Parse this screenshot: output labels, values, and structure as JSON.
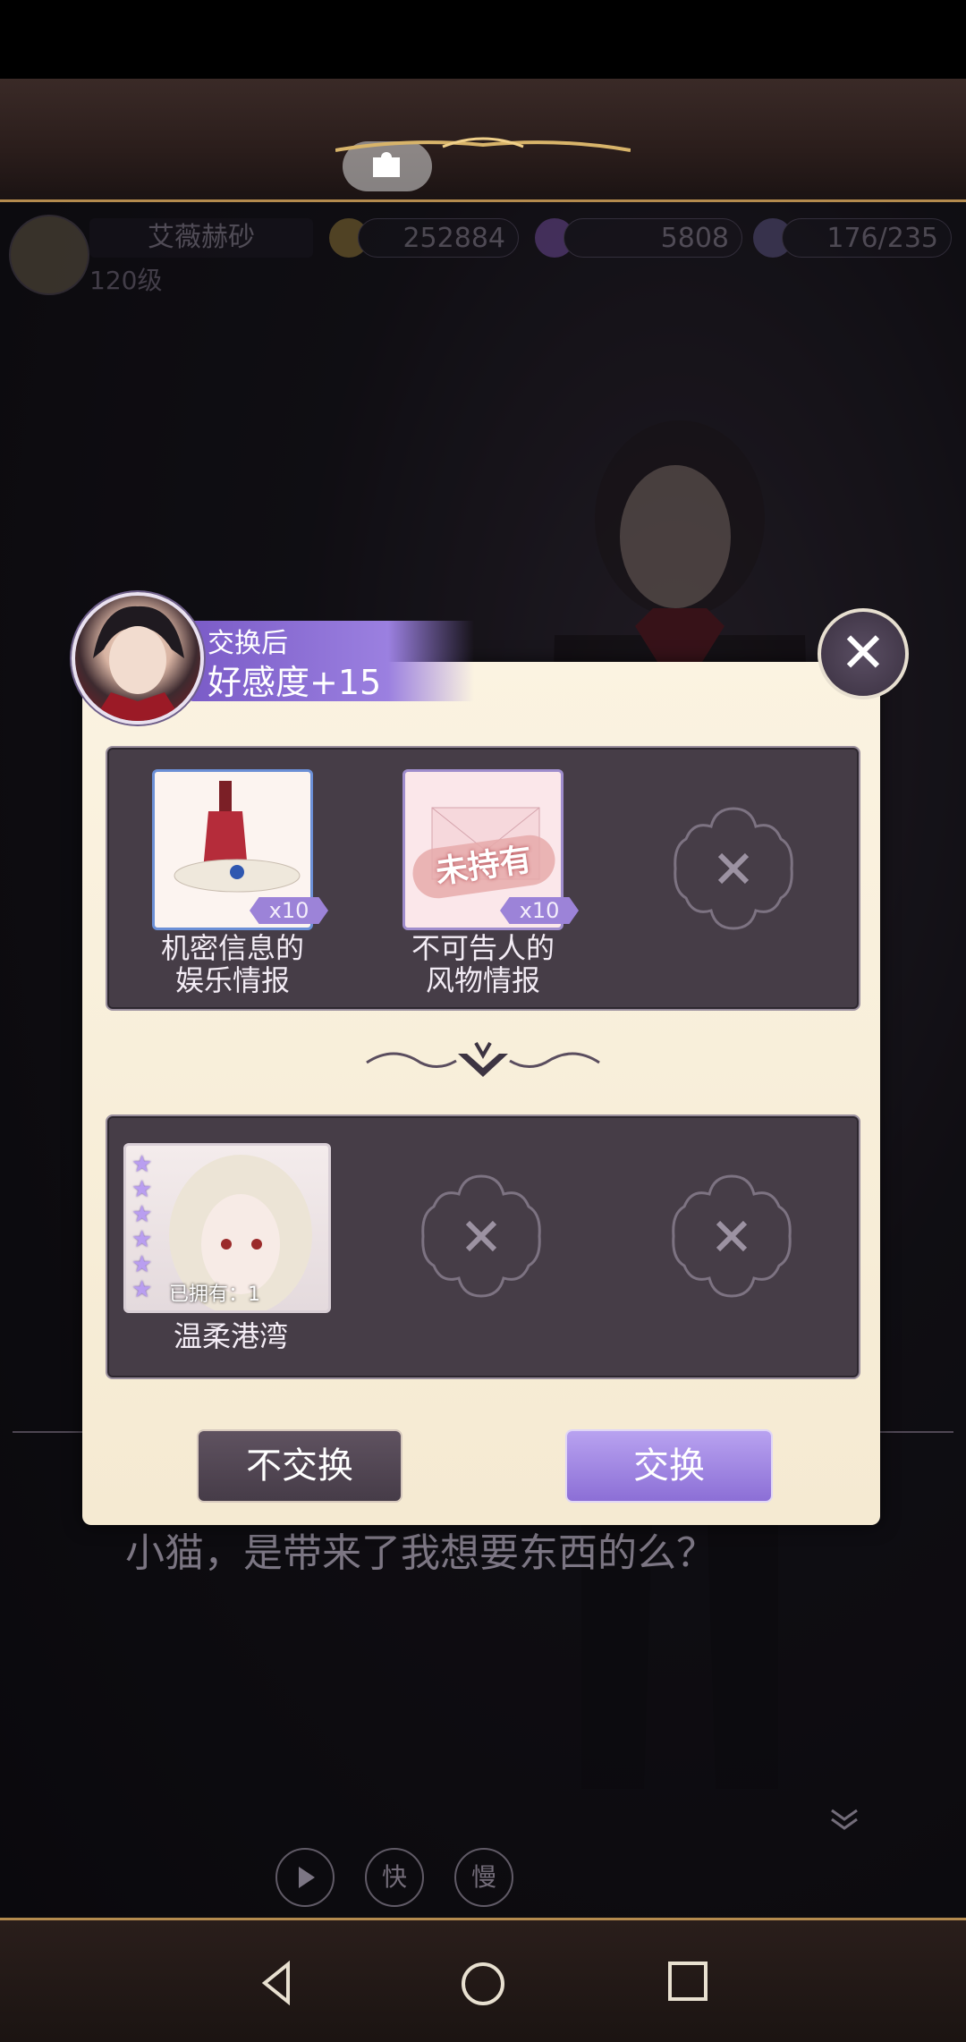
{
  "hud": {
    "player_name": "艾薇赫砂",
    "level": "120级",
    "gold": "252884",
    "gems": "5808",
    "stamina": "176/235"
  },
  "dialogue": {
    "text": "小猫，是带来了我想要东西的么？"
  },
  "controls": {
    "fast": "快",
    "slow": "慢"
  },
  "modal": {
    "banner_line1": "交换后",
    "banner_line2": "好感度+15",
    "close_symbol": "✕",
    "inputs": [
      {
        "name": "机密信息的\n娱乐情报",
        "line1": "机密信息的",
        "line2": "娱乐情报",
        "count": "x10"
      },
      {
        "name": "不可告人的\n风物情报",
        "line1": "不可告人的",
        "line2": "风物情报",
        "count": "x10",
        "status": "未持有"
      }
    ],
    "output": {
      "name": "温柔港湾",
      "owned": "已拥有：1",
      "stars": 6
    },
    "buttons": {
      "decline": "不交换",
      "accept": "交换"
    }
  },
  "colors": {
    "accent_purple": "#9b80e0",
    "parchment": "#f8eed8",
    "panel": "#463d47"
  }
}
